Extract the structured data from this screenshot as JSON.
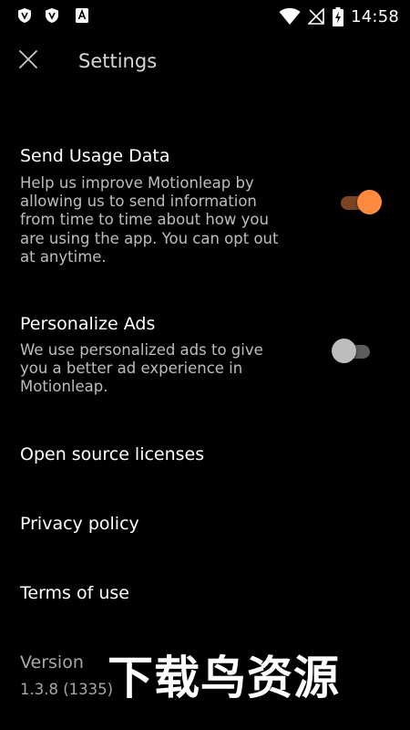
{
  "status_bar": {
    "time": "14:58",
    "left_icons": [
      "shield-v-icon",
      "shield-v-icon",
      "a-notification-icon"
    ],
    "right_icons": [
      "wifi-icon",
      "signal-off-icon",
      "battery-charging-icon"
    ]
  },
  "header": {
    "title": "Settings",
    "close_icon": "close-icon"
  },
  "settings": {
    "usage": {
      "title": "Send Usage Data",
      "desc_lines": [
        "Help us improve Motionleap by",
        "allowing us to send information",
        "from time to time about how you",
        "are using the app. You can opt out",
        "at anytime."
      ],
      "enabled": true
    },
    "ads": {
      "title": "Personalize Ads",
      "desc_lines": [
        "We use personalized ads to give",
        "you a better ad experience in",
        "Motionleap."
      ],
      "enabled": false
    }
  },
  "links": {
    "licenses": "Open source licenses",
    "privacy": "Privacy policy",
    "terms": "Terms of use"
  },
  "version": {
    "label": "Version",
    "value": "1.3.8 (1335)"
  },
  "watermark": "下载鸟资源",
  "colors": {
    "background": "#000000",
    "accent": "#ff8a3d",
    "toggle_on_track": "#7a4424",
    "toggle_off_thumb": "#bdbdbd",
    "toggle_off_track": "#5c5c5c"
  }
}
